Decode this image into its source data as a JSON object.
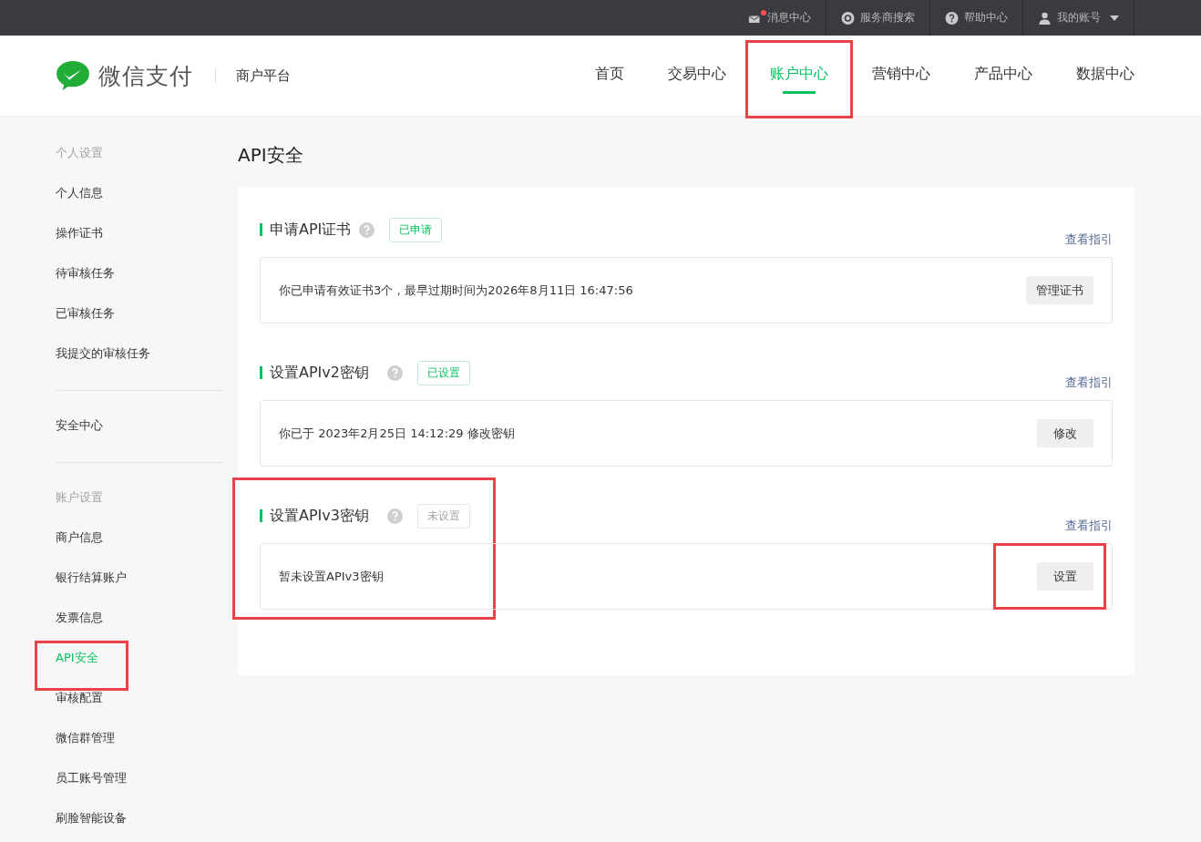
{
  "topbar": [
    {
      "kind": "mail",
      "label": "消息中心",
      "unread": true
    },
    {
      "kind": "search",
      "label": "服务商搜索",
      "unread": false
    },
    {
      "kind": "help",
      "label": "帮助中心",
      "unread": false
    },
    {
      "kind": "account",
      "label": "我的账号",
      "unread": false
    }
  ],
  "brand": {
    "name": "微信支付",
    "sub": "商户平台"
  },
  "nav": [
    {
      "label": "首页",
      "selected": false,
      "highlighted": false
    },
    {
      "label": "交易中心",
      "selected": false,
      "highlighted": false
    },
    {
      "label": "账户中心",
      "selected": true,
      "highlighted": true
    },
    {
      "label": "营销中心",
      "selected": false,
      "highlighted": false
    },
    {
      "label": "产品中心",
      "selected": false,
      "highlighted": false
    },
    {
      "label": "数据中心",
      "selected": false,
      "highlighted": false
    }
  ],
  "sidebar": [
    {
      "heading": "个人设置",
      "items": [
        {
          "label": "个人信息",
          "selected": false,
          "highlighted": false
        },
        {
          "label": "操作证书",
          "selected": false,
          "highlighted": false
        },
        {
          "label": "待审核任务",
          "selected": false,
          "highlighted": false
        },
        {
          "label": "已审核任务",
          "selected": false,
          "highlighted": false
        },
        {
          "label": "我提交的审核任务",
          "selected": false,
          "highlighted": false
        }
      ]
    },
    {
      "items": [
        {
          "label": "安全中心",
          "selected": false,
          "highlighted": false
        }
      ]
    },
    {
      "heading": "账户设置",
      "items": [
        {
          "label": "商户信息",
          "selected": false,
          "highlighted": false
        },
        {
          "label": "银行结算账户",
          "selected": false,
          "highlighted": false
        },
        {
          "label": "发票信息",
          "selected": false,
          "highlighted": false
        },
        {
          "label": "API安全",
          "selected": true,
          "highlighted": true
        },
        {
          "label": "审核配置",
          "selected": false,
          "highlighted": false
        },
        {
          "label": "微信群管理",
          "selected": false,
          "highlighted": false
        },
        {
          "label": "员工账号管理",
          "selected": false,
          "highlighted": false
        },
        {
          "label": "刷脸智能设备",
          "selected": false,
          "highlighted": false
        }
      ]
    }
  ],
  "page_title": "API安全",
  "sections": [
    {
      "title": "申请API证书",
      "applied": true,
      "status_label": "已申请",
      "guide": "查看指引",
      "text": "你已申请有效证书3个，最早过期时间为2026年8月11日 16:47:56",
      "button": "管理证书",
      "highlighted": false,
      "button_highlighted": false
    },
    {
      "title": "设置APIv2密钥",
      "applied": true,
      "status_label": "已设置",
      "guide": "查看指引",
      "text": "你已于 2023年2月25日 14:12:29 修改密钥",
      "button": "修改",
      "highlighted": false,
      "button_highlighted": false
    },
    {
      "title": "设置APIv3密钥",
      "applied": false,
      "status_label": "未设置",
      "guide": "查看指引",
      "text": "暂未设置APIv3密钥",
      "button": "设置",
      "highlighted": true,
      "button_highlighted": true
    }
  ]
}
